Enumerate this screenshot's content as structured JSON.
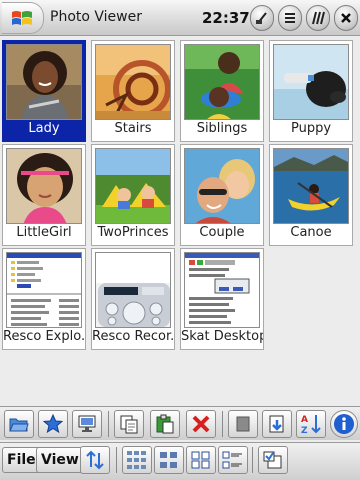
{
  "window": {
    "title": "Photo Viewer",
    "clock": "22:37"
  },
  "title_buttons": [
    "keyboard-icon",
    "list-view-icon",
    "signal-icon",
    "close-icon"
  ],
  "photos": [
    {
      "caption": "Lady",
      "selected": true
    },
    {
      "caption": "Stairs"
    },
    {
      "caption": "Siblings"
    },
    {
      "caption": "Puppy"
    },
    {
      "caption": "LittleGirl"
    },
    {
      "caption": "TwoPrinces"
    },
    {
      "caption": "Couple"
    },
    {
      "caption": "Canoe"
    },
    {
      "caption": "Resco Explo..."
    },
    {
      "caption": "Resco Recor..."
    },
    {
      "caption": "Skat Desktop"
    }
  ],
  "toolbar_top": {
    "buttons": [
      "open-folder-icon",
      "favorite-star-icon",
      "monitor-icon",
      "copy-icon",
      "paste-icon",
      "delete-icon",
      "blank-icon",
      "save-down-icon",
      "sort-az-icon",
      "info-icon"
    ]
  },
  "toolbar_bottom": {
    "file_label": "File",
    "view_label": "View",
    "buttons": [
      "sort-updown-icon",
      "large-thumbs-icon",
      "medium-thumbs-icon",
      "small-thumbs-icon",
      "details-icon",
      "select-icon"
    ]
  }
}
